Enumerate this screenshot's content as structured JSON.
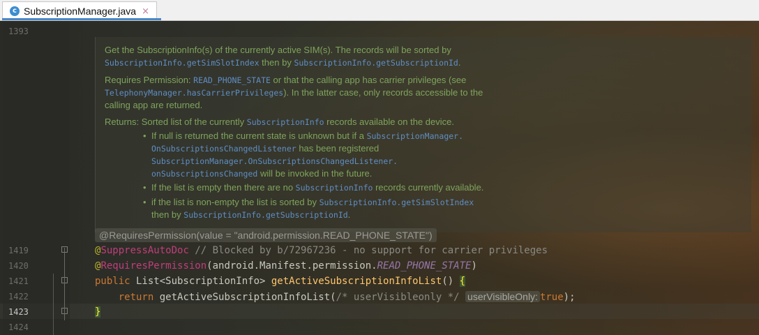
{
  "tab": {
    "icon_letter": "c",
    "title": "SubscriptionManager.java",
    "close": "×"
  },
  "gutter": {
    "lines": [
      "1393",
      "1419",
      "1420",
      "1421",
      "1422",
      "1423",
      "1424"
    ],
    "current": "1423"
  },
  "doc": {
    "p1_a": "Get the SubscriptionInfo(s) of the currently active SIM(s). The records will be sorted by",
    "p1_m1": "SubscriptionInfo.getSimSlotIndex",
    "p1_b": " then by ",
    "p1_m2": "SubscriptionInfo.getSubscriptionId",
    "p1_c": ".",
    "p2_a": "Requires Permission: ",
    "p2_m1": "READ_PHONE_STATE",
    "p2_b": " or that the calling app has carrier privileges (see",
    "p2_m2": "TelephonyManager.hasCarrierPrivileges",
    "p2_c": "). In the latter case, only records accessible to the",
    "p2_d": "calling app are returned.",
    "p3_a": "Returns: Sorted list of the currently ",
    "p3_m1": "SubscriptionInfo",
    "p3_b": " records available on the device.",
    "b1_a": "If null is returned the current state is unknown but if a ",
    "b1_m1": "SubscriptionManager.",
    "b1_m2": "OnSubscriptionsChangedListener",
    "b1_b": " has been registered",
    "b1_m3": "SubscriptionManager.OnSubscriptionsChangedListener.",
    "b1_m4": "onSubscriptionsChanged",
    "b1_c": " will be invoked in the future.",
    "b2_a": "If the list is empty then there are no ",
    "b2_m1": "SubscriptionInfo",
    "b2_b": " records currently available.",
    "b3_a": "if the list is non-empty the list is sorted by ",
    "b3_m1": "SubscriptionInfo.getSimSlotIndex",
    "b3_b": "then by ",
    "b3_m2": "SubscriptionInfo.getSubscriptionId",
    "b3_c": "."
  },
  "inlay_annotation": "@RequiresPermission(value = \"android.permission.READ_PHONE_STATE\")",
  "code": {
    "l1419_at": "@",
    "l1419_ann": "SuppressAutoDoc",
    "l1419_cmt": " // Blocked by b/72967236 - no support for carrier privileges",
    "l1420_at": "@",
    "l1420_ann": "RequiresPermission",
    "l1420_open": "(android.Manifest.permission.",
    "l1420_field": "READ_PHONE_STATE",
    "l1420_close": ")",
    "l1421_kw": "public",
    "l1421_type": " List<SubscriptionInfo> ",
    "l1421_fn": "getActiveSubscriptionInfoList",
    "l1421_parens": "() ",
    "l1421_brace": "{",
    "l1422_indent": "    ",
    "l1422_kw": "return",
    "l1422_call": " getActiveSubscriptionInfoList(",
    "l1422_cmt": "/* userVisibleonly */",
    "l1422_hint": "userVisibleOnly:",
    "l1422_val": "true",
    "l1422_end": ");",
    "l1423_brace": "}"
  },
  "colors": {
    "keyword": "#cc7832",
    "annotation": "#bbb529",
    "method": "#ffc66d",
    "doc_text": "#7fa45d",
    "doc_code": "#5f8ec4"
  }
}
